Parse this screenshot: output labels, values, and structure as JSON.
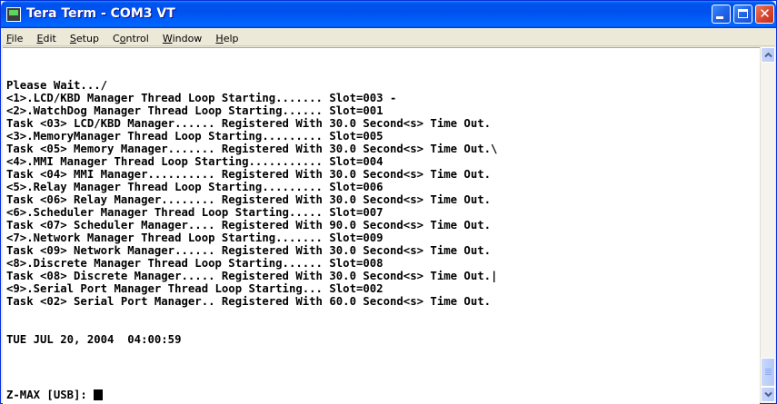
{
  "window": {
    "title": "Tera Term - COM3 VT"
  },
  "menu": [
    {
      "pre": "",
      "key": "F",
      "post": "ile"
    },
    {
      "pre": "",
      "key": "E",
      "post": "dit"
    },
    {
      "pre": "",
      "key": "S",
      "post": "etup"
    },
    {
      "pre": "C",
      "key": "o",
      "post": "ntrol"
    },
    {
      "pre": "",
      "key": "W",
      "post": "indow"
    },
    {
      "pre": "",
      "key": "H",
      "post": "elp"
    }
  ],
  "console": {
    "lines": [
      "Please Wait.../",
      "<1>.LCD/KBD Manager Thread Loop Starting....... Slot=003 -",
      "<2>.WatchDog Manager Thread Loop Starting...... Slot=001",
      "Task <03> LCD/KBD Manager...... Registered With 30.0 Second<s> Time Out.",
      "<3>.MemoryManager Thread Loop Starting......... Slot=005",
      "Task <05> Memory Manager....... Registered With 30.0 Second<s> Time Out.\\",
      "<4>.MMI Manager Thread Loop Starting........... Slot=004",
      "Task <04> MMI Manager.......... Registered With 30.0 Second<s> Time Out.",
      "<5>.Relay Manager Thread Loop Starting......... Slot=006",
      "Task <06> Relay Manager........ Registered With 30.0 Second<s> Time Out.",
      "<6>.Scheduler Manager Thread Loop Starting..... Slot=007",
      "Task <07> Scheduler Manager.... Registered With 90.0 Second<s> Time Out.",
      "<7>.Network Manager Thread Loop Starting....... Slot=009",
      "Task <09> Network Manager...... Registered With 30.0 Second<s> Time Out.",
      "<8>.Discrete Manager Thread Loop Starting...... Slot=008",
      "Task <08> Discrete Manager..... Registered With 30.0 Second<s> Time Out.|",
      "<9>.Serial Port Manager Thread Loop Starting... Slot=002",
      "Task <02> Serial Port Manager.. Registered With 60.0 Second<s> Time Out."
    ],
    "date_line": "TUE JUL 20, 2004  04:00:59",
    "prompt": "Z-MAX [USB]: "
  }
}
